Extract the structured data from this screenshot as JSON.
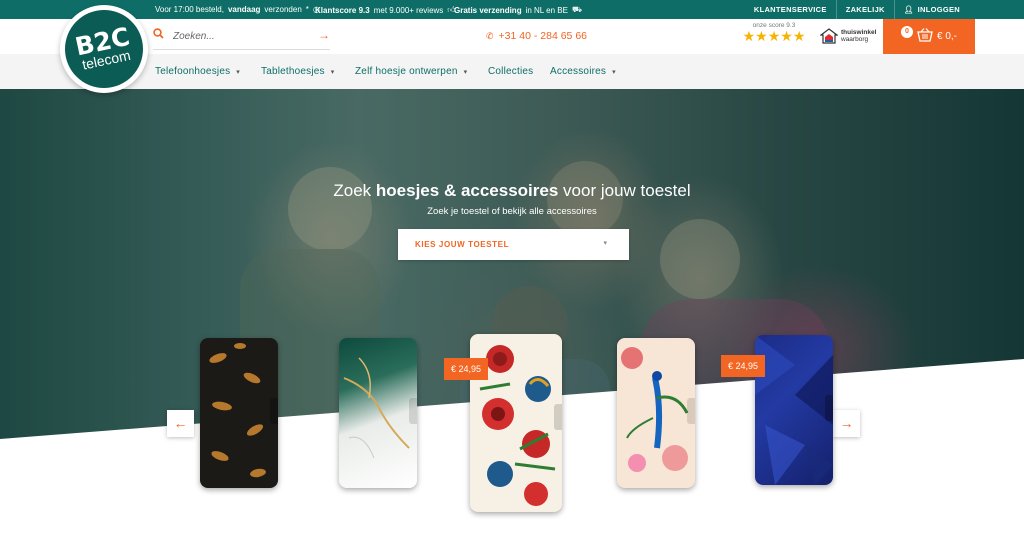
{
  "topbar": {
    "usp1_pre": "Voor 17:00 besteld,",
    "usp1_bold": "vandaag",
    "usp1_post": "verzonden",
    "usp1_mark": "*",
    "usp2_bold": "Klantscore 9.3",
    "usp2_post": "met 9.000+ reviews",
    "usp3_bold": "Gratis verzending",
    "usp3_post": "in NL en BE",
    "links": [
      "KLANTENSERVICE",
      "ZAKELIJK",
      "INLOGGEN"
    ]
  },
  "logo": {
    "line1": "B2C",
    "line2": "telecom"
  },
  "search": {
    "placeholder": "Zoeken..."
  },
  "phone": "+31 40 - 284 65 66",
  "score": {
    "label": "onze score 9.3",
    "stars": "★★★★★"
  },
  "thuiswinkel": {
    "line1": "thuiswinkel",
    "line2": "waarborg"
  },
  "cart": {
    "count": "0",
    "total": "€ 0,-"
  },
  "nav": [
    "Telefoonhoesjes",
    "Tablethoesjes",
    "Zelf hoesje ontwerpen",
    "Collecties",
    "Accessoires"
  ],
  "hero": {
    "title_pre": "Zoek",
    "title_bold": "hoesjes & accessoires",
    "title_post": "voor jouw toestel",
    "subtitle": "Zoek je toestel of bekijk alle accessoires",
    "select": "KIES JOUW TOESTEL"
  },
  "products": [
    {
      "name": "leopard-case",
      "price": ""
    },
    {
      "name": "marble-case",
      "price": ""
    },
    {
      "name": "tattoo-case",
      "price": "€ 24,95"
    },
    {
      "name": "peacock-case",
      "price": ""
    },
    {
      "name": "blue-geometric-case",
      "price": "€ 24,95"
    }
  ],
  "colors": {
    "brand": "#0e6e67",
    "accent": "#f26522",
    "stars": "#f5b400"
  },
  "icons": [
    "clock-icon",
    "thumbs-up-icon",
    "truck-icon",
    "user-icon",
    "search-icon",
    "arrow-right-icon",
    "phone-icon",
    "basket-icon",
    "chevron-down-icon",
    "arrow-left-icon"
  ]
}
